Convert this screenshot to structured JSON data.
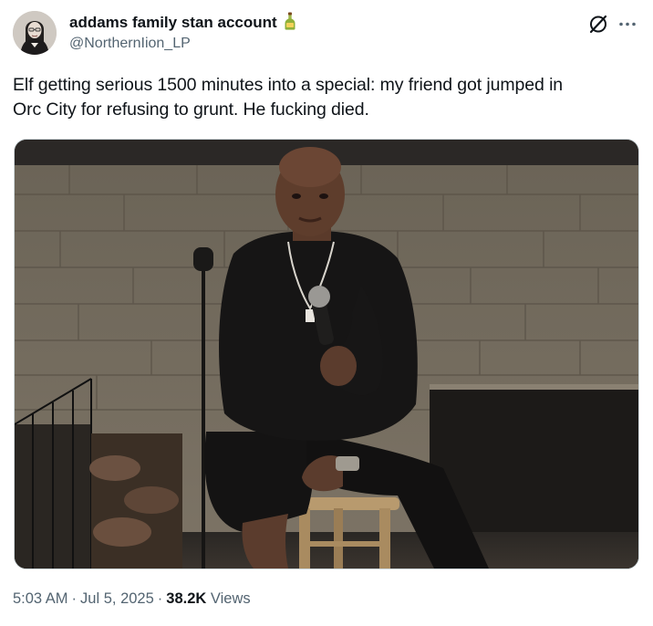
{
  "author": {
    "display_name": "addams family stan account",
    "name_emoji": "bottle-emoji",
    "handle": "@NorthernIion_LP",
    "avatar": "profile-photo"
  },
  "tweet": {
    "text": "Elf getting serious 1500 minutes into a special: my friend got jumped in\nOrc City for refusing to grunt. He fucking died."
  },
  "media": {
    "type": "photo",
    "alt_icons": [
      "microphone",
      "stool",
      "brick-wall",
      "fireplace"
    ]
  },
  "meta": {
    "time": "5:03 AM",
    "separator": "·",
    "date": "Jul 5, 2025",
    "views_count": "38.2K",
    "views_label": "Views"
  },
  "icons": {
    "grok": "grok-icon",
    "more": "more-icon"
  },
  "colors": {
    "text": "#0f1419",
    "secondary": "#536471",
    "border": "#cfd9de"
  }
}
